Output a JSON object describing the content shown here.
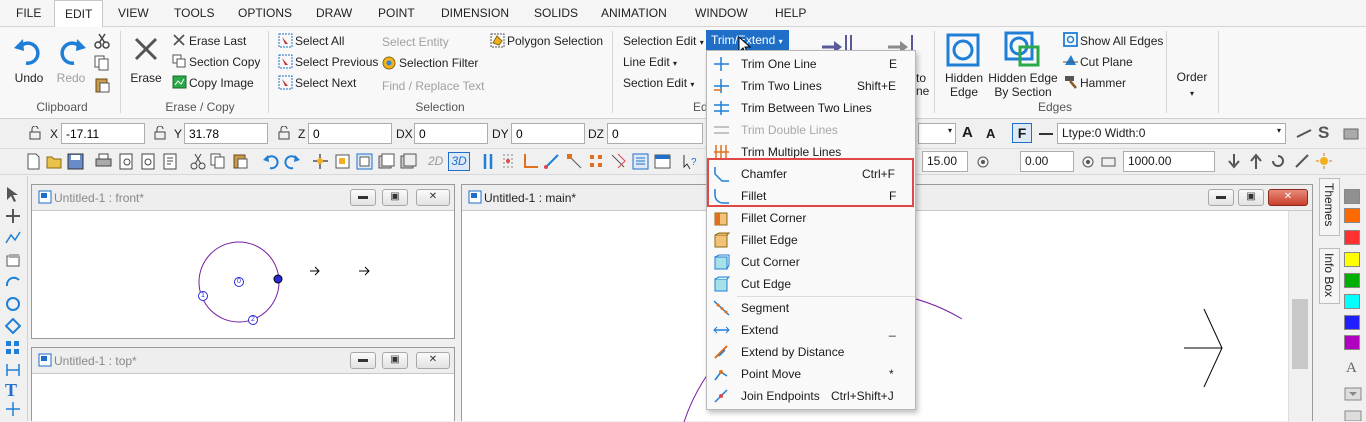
{
  "menu": {
    "items": [
      "FILE",
      "EDIT",
      "VIEW",
      "TOOLS",
      "OPTIONS",
      "DRAW",
      "POINT",
      "DIMENSION",
      "SOLIDS",
      "ANIMATION",
      "WINDOW",
      "HELP"
    ],
    "active": "EDIT"
  },
  "ribbon": {
    "clipboard": {
      "undo": "Undo",
      "redo": "Redo",
      "label": "Clipboard"
    },
    "erase_copy": {
      "erase": "Erase",
      "erase_last": "Erase Last",
      "section_copy": "Section Copy",
      "copy_image": "Copy Image",
      "label": "Erase / Copy"
    },
    "selection": {
      "select_all": "Select All",
      "select_previous": "Select Previous",
      "select_next": "Select Next",
      "select_entity": "Select Entity",
      "selection_filter": "Selection Filter",
      "find_replace": "Find / Replace Text",
      "polygon_selection": "Polygon Selection",
      "label": "Selection"
    },
    "edit": {
      "selection_edit": "Selection Edit",
      "line_edit": "Line Edit",
      "section_edit": "Section Edit",
      "trim_extend": "Trim/Extend",
      "label_partial": "Ed",
      "to": "to",
      "ne": "ne"
    },
    "edges": {
      "hidden_edge": "Hidden\nEdge",
      "hidden_edge_section": "Hidden Edge\nBy Section",
      "show_all_edges": "Show All Edges",
      "cut_plane": "Cut Plane",
      "hammer": "Hammer",
      "label": "Edges"
    },
    "order": {
      "label": "Order"
    }
  },
  "coords": {
    "x_label": "X",
    "x_value": "-17.11",
    "y_label": "Y",
    "y_value": "31.78",
    "z_label": "Z",
    "z_value": "0",
    "dx_label": "DX",
    "dx_value": "0",
    "dy_label": "DY",
    "dy_value": "0",
    "dz_label": "DZ",
    "dz_value": "0",
    "ltype": "Ltype:0  Width:0"
  },
  "toolbar2": {
    "view_2d": "2D",
    "view_3d": "3D",
    "val1": "15.00",
    "val2": "0.00",
    "val3": "1000.00"
  },
  "windows": {
    "front": "Untitled-1 : front*",
    "top": "Untitled-1 : top*",
    "main": "Untitled-1 : main*"
  },
  "markers": {
    "p1": "1",
    "p0": "0",
    "p2": "2"
  },
  "right_tabs": {
    "themes": "Themes",
    "info_box": "Info Box"
  },
  "dropdown": {
    "items": [
      {
        "label": "Trim One Line",
        "shortcut": "E",
        "disabled": false
      },
      {
        "label": "Trim Two Lines",
        "shortcut": "Shift+E",
        "disabled": false
      },
      {
        "label": "Trim Between Two Lines",
        "shortcut": "",
        "disabled": false
      },
      {
        "label": "Trim Double Lines",
        "shortcut": "",
        "disabled": true
      },
      {
        "label": "Trim Multiple Lines",
        "shortcut": "",
        "disabled": false
      },
      {
        "label": "Chamfer",
        "shortcut": "Ctrl+F",
        "disabled": false
      },
      {
        "label": "Fillet",
        "shortcut": "F",
        "disabled": false
      },
      {
        "label": "Fillet Corner",
        "shortcut": "",
        "disabled": false
      },
      {
        "label": "Fillet Edge",
        "shortcut": "",
        "disabled": false
      },
      {
        "label": "Cut Corner",
        "shortcut": "",
        "disabled": false
      },
      {
        "label": "Cut Edge",
        "shortcut": "",
        "disabled": false
      },
      {
        "label": "Segment",
        "shortcut": "",
        "disabled": false
      },
      {
        "label": "Extend",
        "shortcut": "_",
        "disabled": false
      },
      {
        "label": "Extend by Distance",
        "shortcut": "",
        "disabled": false
      },
      {
        "label": "Point Move",
        "shortcut": "*",
        "disabled": false
      },
      {
        "label": "Join Endpoints",
        "shortcut": "Ctrl+Shift+J",
        "disabled": false
      }
    ]
  },
  "colors": {
    "accent_blue": "#1f6fc9",
    "highlight_red": "#e04848",
    "circle_purple": "#7a1fa2",
    "swatches": [
      "#909090",
      "#ff6a00",
      "#ff3030",
      "#ffff00",
      "#00b000",
      "#00ffff",
      "#2020ff",
      "#b000c0"
    ]
  }
}
